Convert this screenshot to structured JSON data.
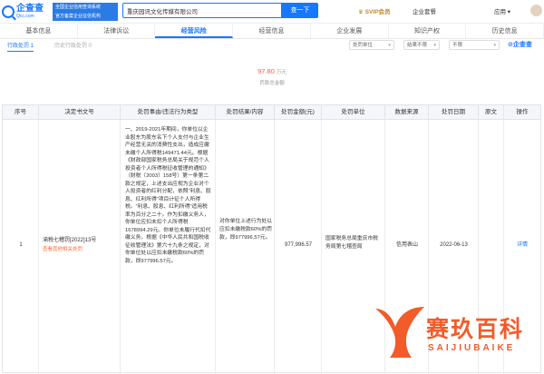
{
  "header": {
    "logo_cn": "企查查",
    "logo_en": "Qcc.com",
    "slogan_line1": "全国企业信用查询系统",
    "slogan_line2": "官方备案企业征信机构",
    "search_value": "重庆园讯文化传媒有限公司",
    "search_button": "查一下",
    "svip": "SVIP会员",
    "enterprise": "企业套餐",
    "app": "应用 ▾"
  },
  "tabs": [
    "基本信息",
    "法律诉讼",
    "经营风险",
    "经营信息",
    "企业发展",
    "知识产权",
    "历史信息"
  ],
  "active_tab": "经营风险",
  "subtabs": {
    "active": "行政处罚 1",
    "inactive": "历史行政处罚 0"
  },
  "filters": [
    "处罚单位",
    "结果不限",
    "不限"
  ],
  "qcc_mark": "企查查",
  "summary": {
    "amount": "97.80",
    "unit": "万元",
    "label": "罚款总金额"
  },
  "table": {
    "headers": [
      "序号",
      "决定书文号",
      "处罚事由/违法行为类型",
      "处罚结果/内容",
      "处罚金额(元)",
      "处罚单位",
      "数据来源",
      "处罚日期",
      "原文",
      "操作"
    ],
    "rows": [
      {
        "index": "1",
        "doc_no": "渝税七稽罚[2022]13号",
        "doc_tag": "查看其他相关处罚",
        "reason": "一、2019-2021年期间，你单位以企业股东为股东名下个人支付与企业生产经营无关的消费性支出，造成应缴未缴个人所得税149471.44元。根据《财政部国家税务总局关于规范个人投资者个人所得税征收管理的通知》（财税〔2003〕158号）第一条第二款之规定，上述支出应视为企业对个人投资者的红利分配，依照“利息、股息、红利所得”项目计征个人所得税。“利息、股息、红利所得”适用税率为百分之二十。作为扣缴义务人，你单位应扣未扣个人所得税1678994.29元。你单位未履行代扣代缴义务，根据《中华人民共和国税收征收管理法》第六十九条之规定，对你单位处以应扣未缴税款60%的罚款，即977996.57元。",
        "result": "对你单位上述行为处以应扣未缴税款60%的罚款，即977996.57元。",
        "amount": "977,996.57",
        "unit": "国家税务总局重庆市税务局第七稽查局",
        "source": "信用表山",
        "date": "2022-06-13",
        "original": "",
        "action": "详情"
      }
    ]
  },
  "watermark": {
    "cn": "赛玖百科",
    "en": "SAIJIUBAIKE"
  },
  "colors": {
    "accent": "#1677ff",
    "amount": "#ff5a3c",
    "watermark": "#f25c2a"
  }
}
